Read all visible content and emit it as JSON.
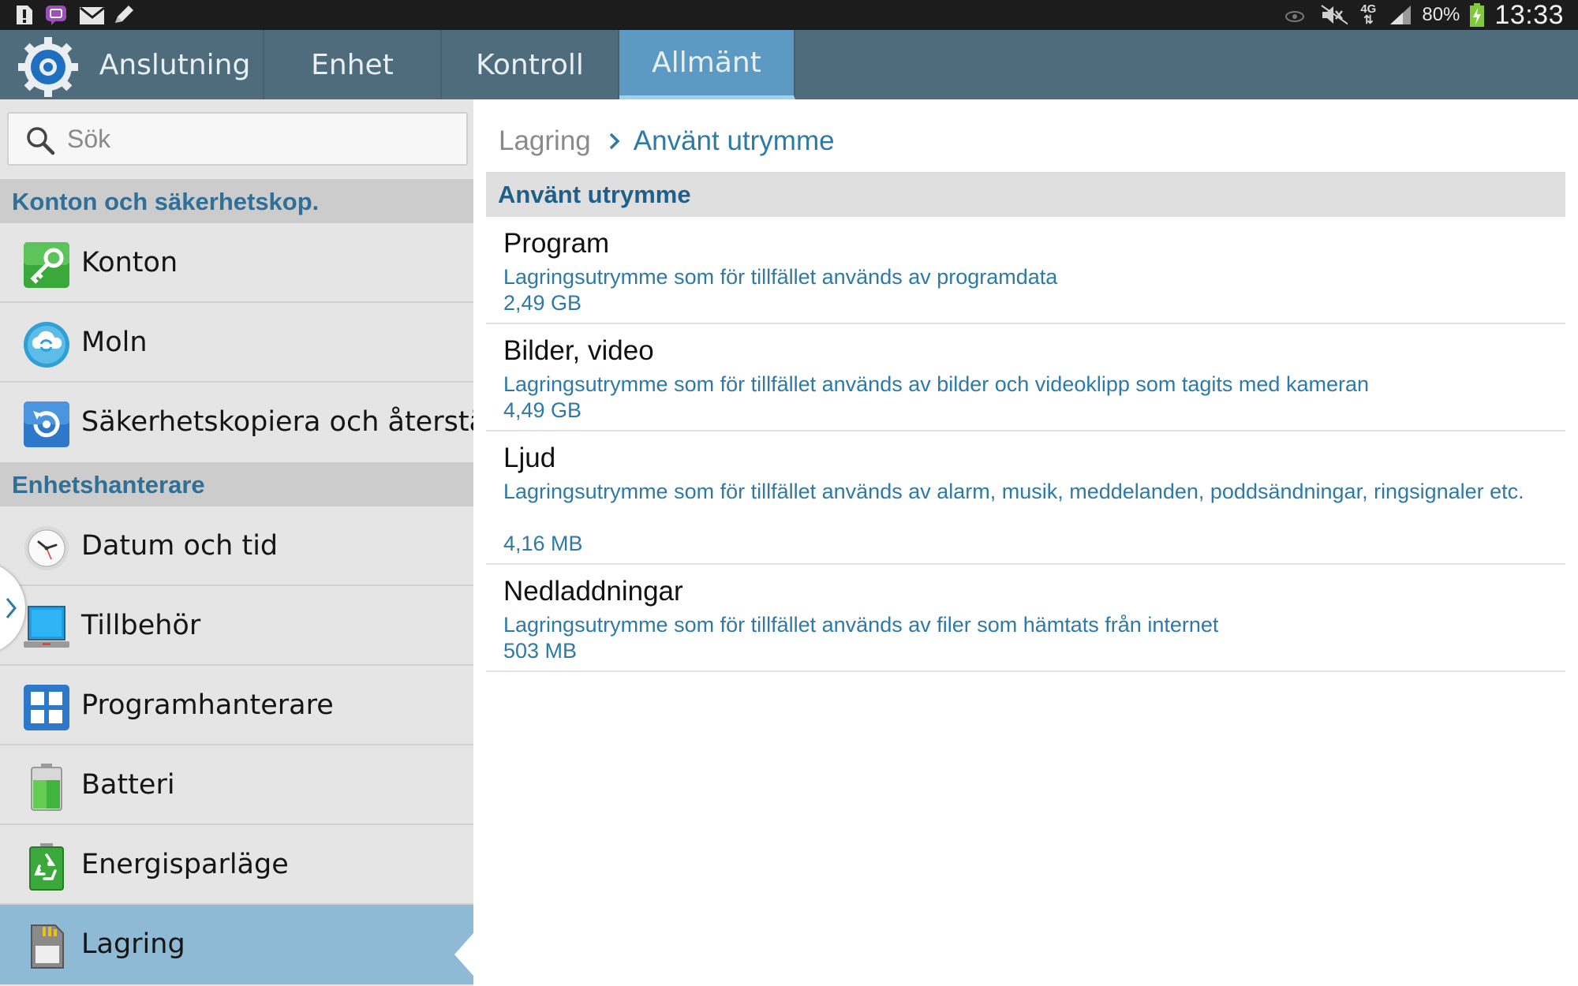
{
  "status_bar": {
    "left_icons": [
      "sd-card-alert-icon",
      "chat-bubble-icon",
      "gmail-icon",
      "pen-icon"
    ],
    "right_icons": [
      "smart-stay-eye-icon",
      "mute-icon",
      "4g-data-icon",
      "signal-icon",
      "battery-charging-icon"
    ],
    "network": "4G",
    "battery_percent": "80%",
    "time": "13:33"
  },
  "tabs": [
    {
      "label": "Anslutning",
      "active": false
    },
    {
      "label": "Enhet",
      "active": false
    },
    {
      "label": "Kontroll",
      "active": false
    },
    {
      "label": "Allmänt",
      "active": true
    }
  ],
  "search": {
    "placeholder": "Sök",
    "value": ""
  },
  "sidebar": {
    "sections": [
      {
        "title": "Konton och säkerhetskop."
      },
      {
        "title": "Enhetshanterare"
      }
    ],
    "items": [
      {
        "label": "Konton",
        "icon": "key-icon"
      },
      {
        "label": "Moln",
        "icon": "cloud-icon"
      },
      {
        "label": "Säkerhetskopiera och återställ",
        "icon": "backup-restore-icon"
      },
      {
        "label": "Datum och tid",
        "icon": "clock-icon"
      },
      {
        "label": "Tillbehör",
        "icon": "accessory-icon"
      },
      {
        "label": "Programhanterare",
        "icon": "app-grid-icon"
      },
      {
        "label": "Batteri",
        "icon": "battery-icon"
      },
      {
        "label": "Energisparläge",
        "icon": "power-saving-icon"
      },
      {
        "label": "Lagring",
        "icon": "storage-icon",
        "selected": true
      }
    ]
  },
  "breadcrumb": {
    "root": "Lagring",
    "current": "Använt utrymme"
  },
  "content": {
    "header": "Använt utrymme",
    "rows": [
      {
        "title": "Program",
        "desc": "Lagringsutrymme som för tillfället används av programdata",
        "size": "2,49 GB"
      },
      {
        "title": "Bilder, video",
        "desc": "Lagringsutrymme som för tillfället används av bilder och videoklipp som tagits med kameran",
        "size": "4,49 GB"
      },
      {
        "title": "Ljud",
        "desc": "Lagringsutrymme som för tillfället används av alarm, musik, meddelanden, poddsändningar, ringsignaler etc.",
        "size": "4,16 MB"
      },
      {
        "title": "Nedladdningar",
        "desc": "Lagringsutrymme som för tillfället används av filer som hämtats från internet",
        "size": "503 MB"
      }
    ]
  },
  "colors": {
    "tab_bar": "#4f6c7d",
    "tab_active": "#5c9ac4",
    "section_text": "#2f6f98",
    "accent_text": "#2e79a8",
    "sidebar_bg": "#e4e5e4",
    "sidebar_selected": "#8fbad6"
  }
}
